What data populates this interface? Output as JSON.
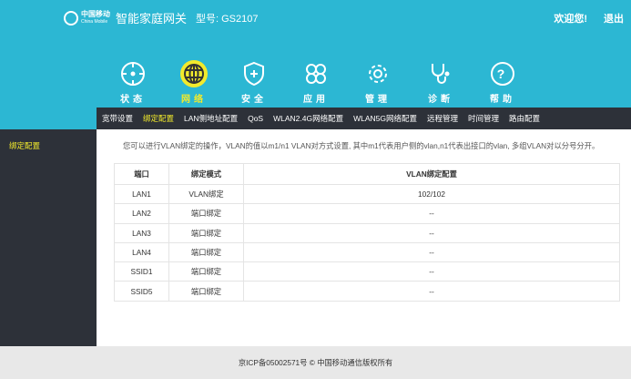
{
  "header": {
    "logo_cn": "中国移动",
    "logo_en": "China Mobile",
    "product": "智能家庭网关",
    "model": "型号: GS2107",
    "welcome": "欢迎您!",
    "logout": "退出"
  },
  "menu": [
    {
      "label": "状态",
      "icon": "status-icon"
    },
    {
      "label": "网络",
      "icon": "globe-icon",
      "active": true
    },
    {
      "label": "安全",
      "icon": "shield-icon"
    },
    {
      "label": "应用",
      "icon": "apps-icon"
    },
    {
      "label": "管理",
      "icon": "gear-icon"
    },
    {
      "label": "诊断",
      "icon": "stethoscope-icon"
    },
    {
      "label": "帮助",
      "icon": "help-icon"
    }
  ],
  "subnav": [
    "宽带设置",
    "绑定配置",
    "LAN侧地址配置",
    "QoS",
    "WLAN2.4G网络配置",
    "WLAN5G网络配置",
    "远程管理",
    "时间管理",
    "路由配置"
  ],
  "sidebar": {
    "item": "绑定配置"
  },
  "description": "您可以进行VLAN绑定的操作，VLAN的值以m1/n1 VLAN对方式设置, 其中m1代表用户侧的vlan,n1代表出接口的vlan, 多组VLAN对以分号分开。",
  "table": {
    "headers": [
      "端口",
      "绑定模式",
      "VLAN绑定配置"
    ],
    "rows": [
      [
        "LAN1",
        "VLAN绑定",
        "102/102"
      ],
      [
        "LAN2",
        "端口绑定",
        "--"
      ],
      [
        "LAN3",
        "端口绑定",
        "--"
      ],
      [
        "LAN4",
        "端口绑定",
        "--"
      ],
      [
        "SSID1",
        "端口绑定",
        "--"
      ],
      [
        "SSID5",
        "端口绑定",
        "--"
      ]
    ]
  },
  "footer": "京ICP备05002571号 © 中国移动通信版权所有",
  "colors": {
    "header": "#2cb7d3",
    "dark": "#2d3139",
    "active": "#f2ea2c"
  }
}
